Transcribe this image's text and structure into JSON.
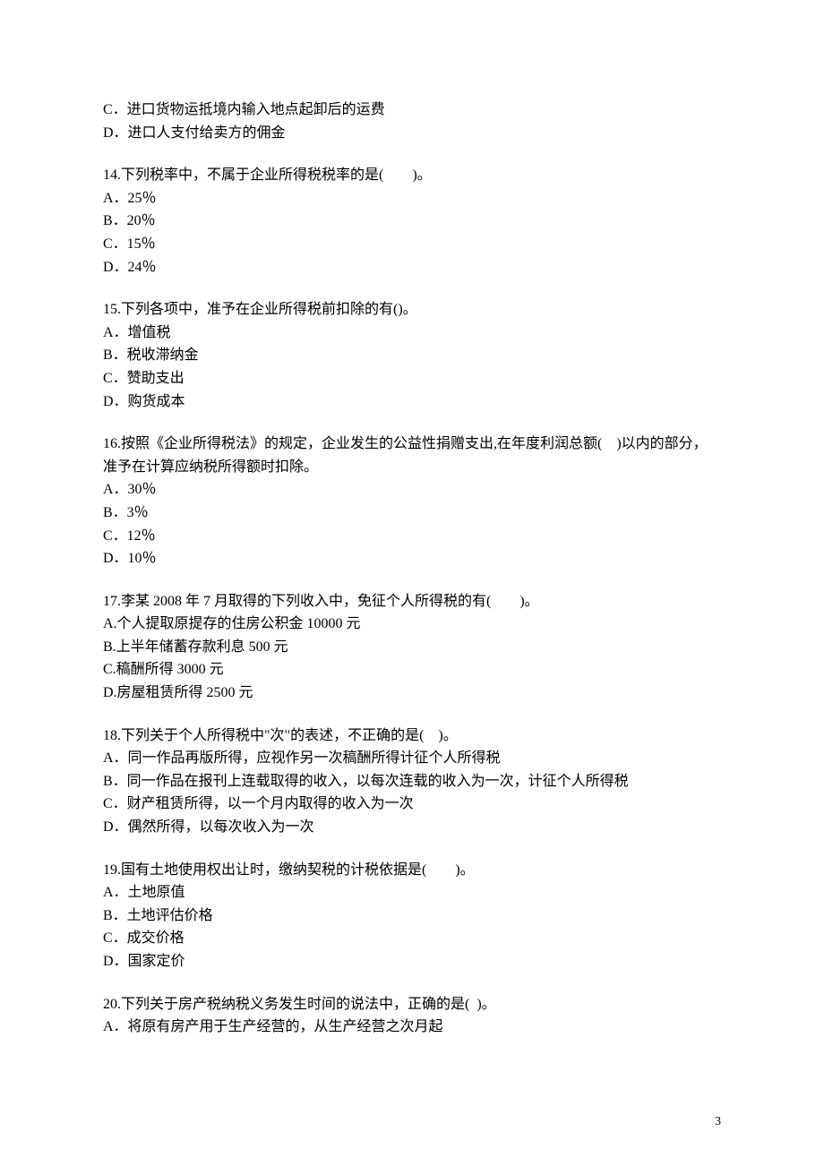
{
  "page_number": "3",
  "fragment_top": {
    "options": [
      "C．进口货物运抵境内输入地点起卸后的运费",
      "D．进口人支付给卖方的佣金"
    ]
  },
  "questions": [
    {
      "stem": "14.下列税率中，不属于企业所得税税率的是(　　)。",
      "options": [
        "A．25％",
        "B．20％",
        "C．15％",
        "D．24％"
      ]
    },
    {
      "stem": "15.下列各项中，准予在企业所得税前扣除的有()。",
      "options": [
        "A．增值税",
        "B．税收滞纳金",
        "C．赞助支出",
        "D．购货成本"
      ]
    },
    {
      "stem": "16.按照《企业所得税法》的规定，企业发生的公益性捐赠支出,在年度利润总额(　)以内的部分，准予在计算应纳税所得额时扣除。",
      "options": [
        "A．30％",
        "B．3％",
        "C．12％",
        "D．10％"
      ]
    },
    {
      "stem": "17.李某 2008 年 7 月取得的下列收入中，免征个人所得税的有(　　)。",
      "options": [
        "A.个人提取原提存的住房公积金 10000 元",
        "B.上半年储蓄存款利息 500 元",
        "C.稿酬所得 3000 元",
        "D.房屋租赁所得 2500 元"
      ]
    },
    {
      "stem": "18.下列关于个人所得税中\"次\"的表述，不正确的是(　)。",
      "options": [
        "A．同一作品再版所得，应视作另一次稿酬所得计征个人所得税",
        "B．同一作品在报刊上连载取得的收入，以每次连载的收入为一次，计征个人所得税",
        "C．财产租赁所得，以一个月内取得的收入为一次",
        "D．偶然所得，以每次收入为一次"
      ]
    },
    {
      "stem": "19.国有土地使用权出让时，缴纳契税的计税依据是(　　)。",
      "options": [
        "A．土地原值",
        "B．土地评估价格",
        "C．成交价格",
        "D．国家定价"
      ]
    },
    {
      "stem": "20.下列关于房产税纳税义务发生时间的说法中，正确的是(  )。",
      "options": [
        "A．将原有房产用于生产经营的，从生产经营之次月起"
      ]
    }
  ]
}
